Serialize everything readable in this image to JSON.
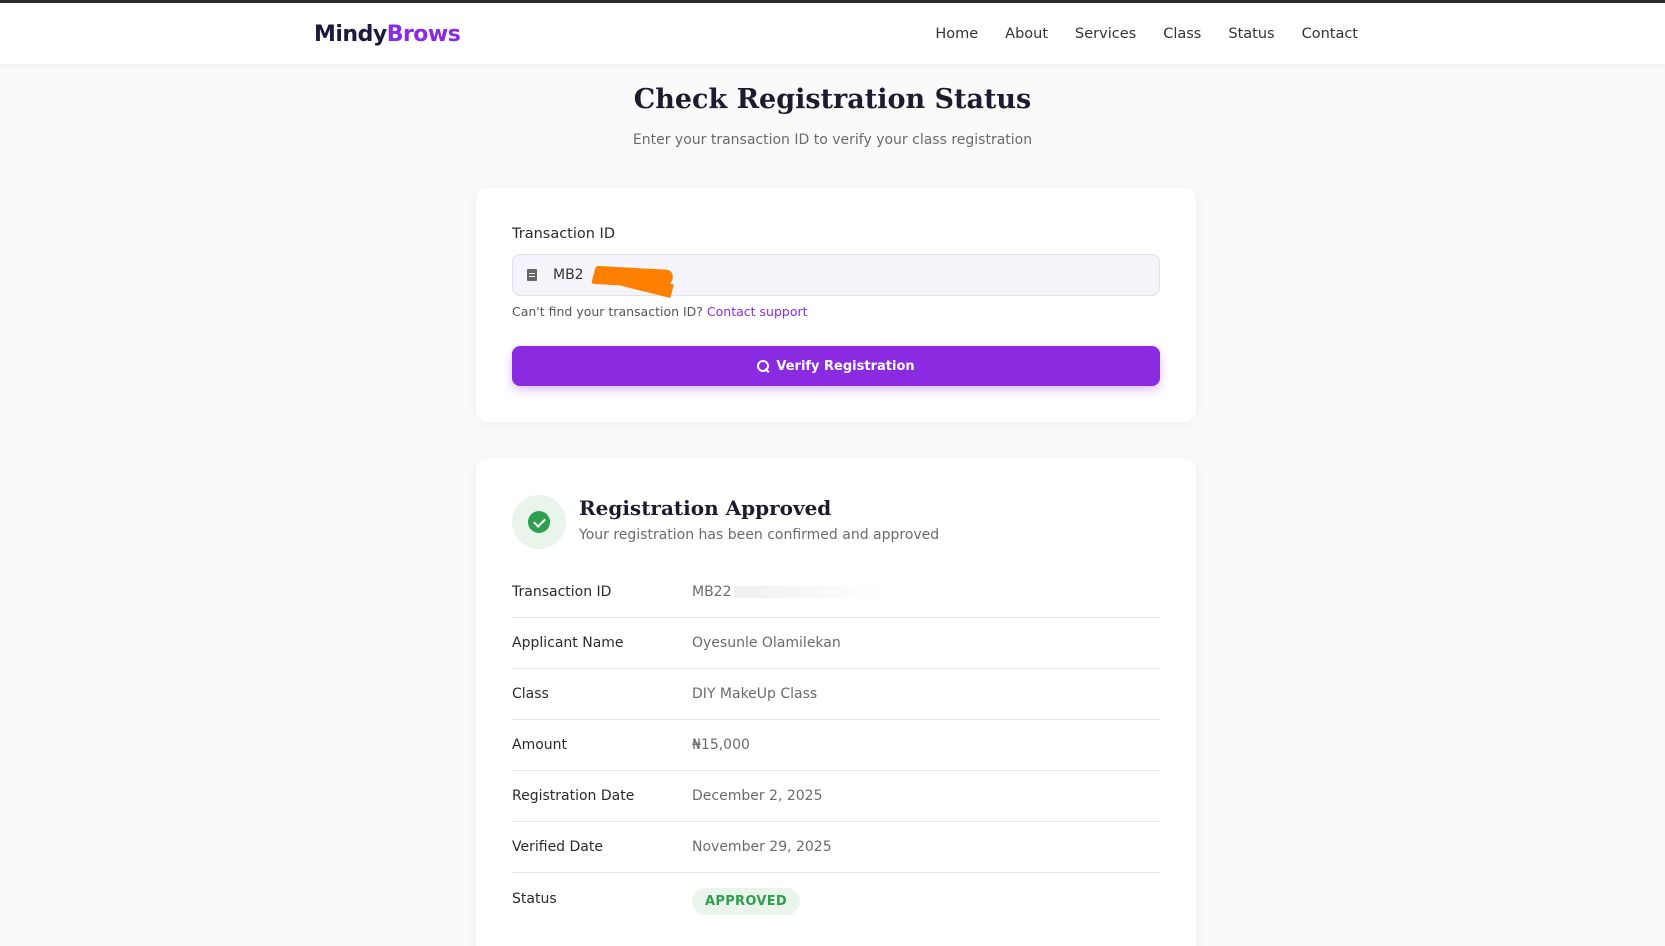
{
  "brand": {
    "part1": "Mindy",
    "part2": "Brows"
  },
  "nav": [
    "Home",
    "About",
    "Services",
    "Class",
    "Status",
    "Contact"
  ],
  "page": {
    "title": "Check Registration Status",
    "subtitle": "Enter your transaction ID to verify your class registration"
  },
  "form": {
    "label": "Transaction ID",
    "value": "MB2",
    "help_text": "Can't find your transaction ID?",
    "help_link": "Contact support",
    "button_label": "Verify Registration"
  },
  "result": {
    "title": "Registration Approved",
    "subtitle": "Your registration has been confirmed and approved",
    "rows": [
      {
        "label": "Transaction ID",
        "value": "MB22"
      },
      {
        "label": "Applicant Name",
        "value": "Oyesunle Olamilekan"
      },
      {
        "label": "Class",
        "value": "DIY MakeUp Class"
      },
      {
        "label": "Amount",
        "value": "₦15,000"
      },
      {
        "label": "Registration Date",
        "value": "December 2, 2025"
      },
      {
        "label": "Verified Date",
        "value": "November 29, 2025"
      },
      {
        "label": "Status",
        "value": "APPROVED"
      }
    ]
  },
  "colors": {
    "accent": "#8a2be2",
    "success": "#2e9e4f",
    "redaction": "#ff7f00"
  },
  "icons": [
    "document-icon",
    "search-icon",
    "check-circle-icon"
  ]
}
